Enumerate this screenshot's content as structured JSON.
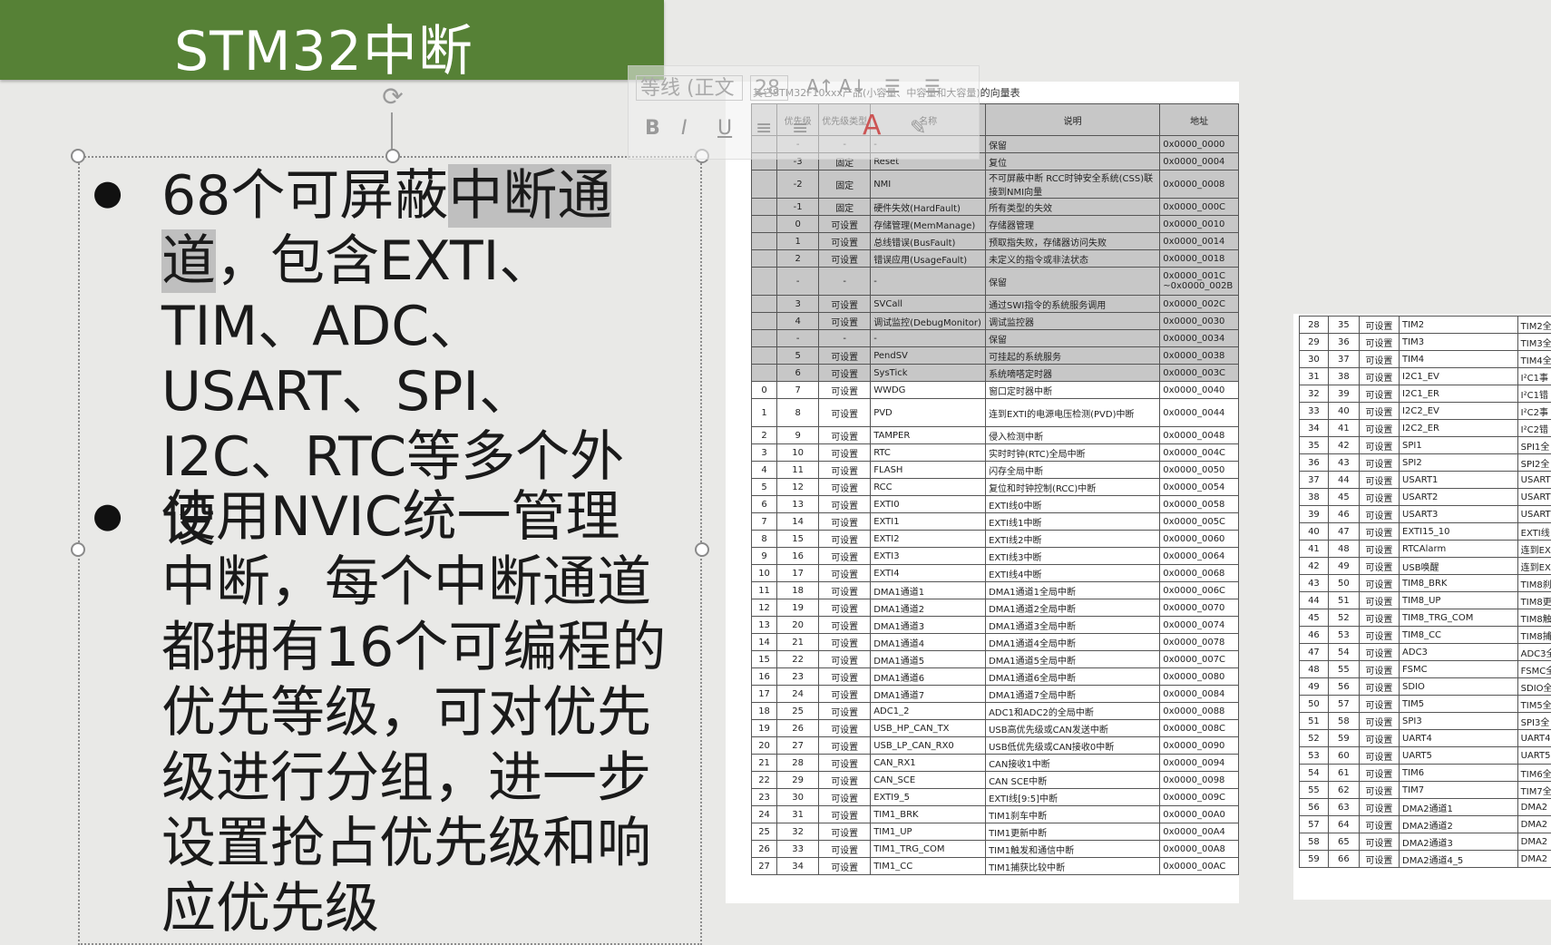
{
  "title": "STM32中断",
  "bullets": [
    {
      "pre": "68个可屏蔽",
      "highlight": "中断通道",
      "post": "，包含EXTI、TIM、ADC、USART、SPI、I2C、RTC等多个外设"
    },
    {
      "pre": "使用NVIC统一管理中断，每个中断通道都拥有16个可编程的优先等级，可对优先级进行分组，进一步设置抢占优先级和响应优先级",
      "highlight": "",
      "post": ""
    }
  ],
  "toolbar": {
    "font": "等线 (正文",
    "size": "28",
    "bold": "B",
    "italic": "I",
    "underline": "U",
    "color": "A"
  },
  "table_main": {
    "title": "其它STM32F10xxx产品(小容量、中容量和大容量)的向量表",
    "headers": [
      "",
      "优先级",
      "优先级类型",
      "名称",
      "说明",
      "地址"
    ],
    "rows": [
      [
        "",
        "-",
        "-",
        "-",
        "保留",
        "0x0000_0000"
      ],
      [
        "",
        "-3",
        "固定",
        "Reset",
        "复位",
        "0x0000_0004"
      ],
      [
        "",
        "-2",
        "固定",
        "NMI",
        "不可屏蔽中断 RCC时钟安全系统(CSS)联接到NMI向量",
        "0x0000_0008"
      ],
      [
        "",
        "-1",
        "固定",
        "硬件失效(HardFault)",
        "所有类型的失效",
        "0x0000_000C"
      ],
      [
        "",
        "0",
        "可设置",
        "存储管理(MemManage)",
        "存储器管理",
        "0x0000_0010"
      ],
      [
        "",
        "1",
        "可设置",
        "总线错误(BusFault)",
        "预取指失败，存储器访问失败",
        "0x0000_0014"
      ],
      [
        "",
        "2",
        "可设置",
        "错误应用(UsageFault)",
        "未定义的指令或非法状态",
        "0x0000_0018"
      ],
      [
        "",
        "-",
        "-",
        "-",
        "保留",
        "0x0000_001C ~0x0000_002B"
      ],
      [
        "",
        "3",
        "可设置",
        "SVCall",
        "通过SWI指令的系统服务调用",
        "0x0000_002C"
      ],
      [
        "",
        "4",
        "可设置",
        "调试监控(DebugMonitor)",
        "调试监控器",
        "0x0000_0030"
      ],
      [
        "",
        "-",
        "-",
        "-",
        "保留",
        "0x0000_0034"
      ],
      [
        "",
        "5",
        "可设置",
        "PendSV",
        "可挂起的系统服务",
        "0x0000_0038"
      ],
      [
        "",
        "6",
        "可设置",
        "SysTick",
        "系统嘀嗒定时器",
        "0x0000_003C"
      ],
      [
        "0",
        "7",
        "可设置",
        "WWDG",
        "窗口定时器中断",
        "0x0000_0040"
      ],
      [
        "1",
        "8",
        "可设置",
        "PVD",
        "连到EXTI的电源电压检测(PVD)中断",
        "0x0000_0044"
      ],
      [
        "2",
        "9",
        "可设置",
        "TAMPER",
        "侵入检测中断",
        "0x0000_0048"
      ],
      [
        "3",
        "10",
        "可设置",
        "RTC",
        "实时时钟(RTC)全局中断",
        "0x0000_004C"
      ],
      [
        "4",
        "11",
        "可设置",
        "FLASH",
        "闪存全局中断",
        "0x0000_0050"
      ],
      [
        "5",
        "12",
        "可设置",
        "RCC",
        "复位和时钟控制(RCC)中断",
        "0x0000_0054"
      ],
      [
        "6",
        "13",
        "可设置",
        "EXTI0",
        "EXTI线0中断",
        "0x0000_0058"
      ],
      [
        "7",
        "14",
        "可设置",
        "EXTI1",
        "EXTI线1中断",
        "0x0000_005C"
      ],
      [
        "8",
        "15",
        "可设置",
        "EXTI2",
        "EXTI线2中断",
        "0x0000_0060"
      ],
      [
        "9",
        "16",
        "可设置",
        "EXTI3",
        "EXTI线3中断",
        "0x0000_0064"
      ],
      [
        "10",
        "17",
        "可设置",
        "EXTI4",
        "EXTI线4中断",
        "0x0000_0068"
      ],
      [
        "11",
        "18",
        "可设置",
        "DMA1通道1",
        "DMA1通道1全局中断",
        "0x0000_006C"
      ],
      [
        "12",
        "19",
        "可设置",
        "DMA1通道2",
        "DMA1通道2全局中断",
        "0x0000_0070"
      ],
      [
        "13",
        "20",
        "可设置",
        "DMA1通道3",
        "DMA1通道3全局中断",
        "0x0000_0074"
      ],
      [
        "14",
        "21",
        "可设置",
        "DMA1通道4",
        "DMA1通道4全局中断",
        "0x0000_0078"
      ],
      [
        "15",
        "22",
        "可设置",
        "DMA1通道5",
        "DMA1通道5全局中断",
        "0x0000_007C"
      ],
      [
        "16",
        "23",
        "可设置",
        "DMA1通道6",
        "DMA1通道6全局中断",
        "0x0000_0080"
      ],
      [
        "17",
        "24",
        "可设置",
        "DMA1通道7",
        "DMA1通道7全局中断",
        "0x0000_0084"
      ],
      [
        "18",
        "25",
        "可设置",
        "ADC1_2",
        "ADC1和ADC2的全局中断",
        "0x0000_0088"
      ],
      [
        "19",
        "26",
        "可设置",
        "USB_HP_CAN_TX",
        "USB高优先级或CAN发送中断",
        "0x0000_008C"
      ],
      [
        "20",
        "27",
        "可设置",
        "USB_LP_CAN_RX0",
        "USB低优先级或CAN接收0中断",
        "0x0000_0090"
      ],
      [
        "21",
        "28",
        "可设置",
        "CAN_RX1",
        "CAN接收1中断",
        "0x0000_0094"
      ],
      [
        "22",
        "29",
        "可设置",
        "CAN_SCE",
        "CAN SCE中断",
        "0x0000_0098"
      ],
      [
        "23",
        "30",
        "可设置",
        "EXTI9_5",
        "EXTI线[9:5]中断",
        "0x0000_009C"
      ],
      [
        "24",
        "31",
        "可设置",
        "TIM1_BRK",
        "TIM1刹车中断",
        "0x0000_00A0"
      ],
      [
        "25",
        "32",
        "可设置",
        "TIM1_UP",
        "TIM1更新中断",
        "0x0000_00A4"
      ],
      [
        "26",
        "33",
        "可设置",
        "TIM1_TRG_COM",
        "TIM1触发和通信中断",
        "0x0000_00A8"
      ],
      [
        "27",
        "34",
        "可设置",
        "TIM1_CC",
        "TIM1捕获比较中断",
        "0x0000_00AC"
      ]
    ]
  },
  "table_side": {
    "rows": [
      [
        "28",
        "35",
        "可设置",
        "TIM2",
        "TIM2全"
      ],
      [
        "29",
        "36",
        "可设置",
        "TIM3",
        "TIM3全"
      ],
      [
        "30",
        "37",
        "可设置",
        "TIM4",
        "TIM4全"
      ],
      [
        "31",
        "38",
        "可设置",
        "I2C1_EV",
        "I²C1事"
      ],
      [
        "32",
        "39",
        "可设置",
        "I2C1_ER",
        "I²C1错"
      ],
      [
        "33",
        "40",
        "可设置",
        "I2C2_EV",
        "I²C2事"
      ],
      [
        "34",
        "41",
        "可设置",
        "I2C2_ER",
        "I²C2错"
      ],
      [
        "35",
        "42",
        "可设置",
        "SPI1",
        "SPI1全"
      ],
      [
        "36",
        "43",
        "可设置",
        "SPI2",
        "SPI2全"
      ],
      [
        "37",
        "44",
        "可设置",
        "USART1",
        "USART"
      ],
      [
        "38",
        "45",
        "可设置",
        "USART2",
        "USART"
      ],
      [
        "39",
        "46",
        "可设置",
        "USART3",
        "USART"
      ],
      [
        "40",
        "47",
        "可设置",
        "EXTI15_10",
        "EXTI线"
      ],
      [
        "41",
        "48",
        "可设置",
        "RTCAlarm",
        "连到EX"
      ],
      [
        "42",
        "49",
        "可设置",
        "USB唤醒",
        "连到EX"
      ],
      [
        "43",
        "50",
        "可设置",
        "TIM8_BRK",
        "TIM8刹"
      ],
      [
        "44",
        "51",
        "可设置",
        "TIM8_UP",
        "TIM8更"
      ],
      [
        "45",
        "52",
        "可设置",
        "TIM8_TRG_COM",
        "TIM8触"
      ],
      [
        "46",
        "53",
        "可设置",
        "TIM8_CC",
        "TIM8捕"
      ],
      [
        "47",
        "54",
        "可设置",
        "ADC3",
        "ADC3全"
      ],
      [
        "48",
        "55",
        "可设置",
        "FSMC",
        "FSMC全"
      ],
      [
        "49",
        "56",
        "可设置",
        "SDIO",
        "SDIO全"
      ],
      [
        "50",
        "57",
        "可设置",
        "TIM5",
        "TIM5全"
      ],
      [
        "51",
        "58",
        "可设置",
        "SPI3",
        "SPI3全"
      ],
      [
        "52",
        "59",
        "可设置",
        "UART4",
        "UART4"
      ],
      [
        "53",
        "60",
        "可设置",
        "UART5",
        "UART5"
      ],
      [
        "54",
        "61",
        "可设置",
        "TIM6",
        "TIM6全"
      ],
      [
        "55",
        "62",
        "可设置",
        "TIM7",
        "TIM7全"
      ],
      [
        "56",
        "63",
        "可设置",
        "DMA2通道1",
        "DMA2"
      ],
      [
        "57",
        "64",
        "可设置",
        "DMA2通道2",
        "DMA2"
      ],
      [
        "58",
        "65",
        "可设置",
        "DMA2通道3",
        "DMA2"
      ],
      [
        "59",
        "66",
        "可设置",
        "DMA2通道4_5",
        "DMA2"
      ]
    ]
  }
}
